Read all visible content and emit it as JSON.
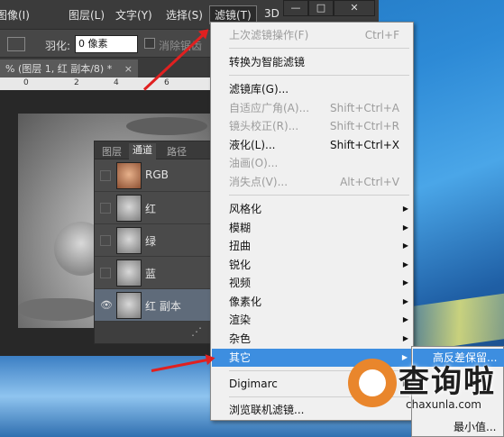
{
  "app": {
    "menubar": {
      "items": [
        "图像(I)",
        "图层(L)",
        "文字(Y)",
        "选择(S)",
        "滤镜(T)",
        "3D"
      ],
      "active": "滤镜(T)"
    },
    "window_controls": {
      "minimize": "—",
      "maximize": "□",
      "close": "✕"
    },
    "options": {
      "feather_label": "羽化:",
      "feather_value": "0 像素",
      "antialias_label": "消除锯齿"
    },
    "document_tab": {
      "title": "% (图层 1, 红 副本/8) *",
      "close": "×"
    },
    "ruler_ticks": [
      "0",
      "2",
      "4",
      "6"
    ]
  },
  "channels_panel": {
    "tabs": [
      "图层",
      "通道",
      "路径"
    ],
    "active_tab": "通道",
    "rows": [
      {
        "label": "RGB",
        "visible": false
      },
      {
        "label": "红",
        "visible": false
      },
      {
        "label": "绿",
        "visible": false
      },
      {
        "label": "蓝",
        "visible": false
      },
      {
        "label": "红 副本",
        "visible": true
      }
    ],
    "eye_icon": "👁",
    "footer_icon": "⋰"
  },
  "filter_menu": {
    "items": [
      {
        "label": "上次滤镜操作(F)",
        "shortcut": "Ctrl+F",
        "disabled": true
      },
      {
        "label": "转换为智能滤镜"
      },
      {
        "label": "滤镜库(G)..."
      },
      {
        "label": "自适应广角(A)...",
        "shortcut": "Shift+Ctrl+A",
        "disabled": true
      },
      {
        "label": "镜头校正(R)...",
        "shortcut": "Shift+Ctrl+R",
        "disabled": true
      },
      {
        "label": "液化(L)...",
        "shortcut": "Shift+Ctrl+X"
      },
      {
        "label": "油画(O)...",
        "disabled": true
      },
      {
        "label": "消失点(V)...",
        "shortcut": "Alt+Ctrl+V",
        "disabled": true
      },
      {
        "label": "风格化",
        "submenu": true
      },
      {
        "label": "模糊",
        "submenu": true
      },
      {
        "label": "扭曲",
        "submenu": true
      },
      {
        "label": "锐化",
        "submenu": true
      },
      {
        "label": "视频",
        "submenu": true
      },
      {
        "label": "像素化",
        "submenu": true
      },
      {
        "label": "渲染",
        "submenu": true
      },
      {
        "label": "杂色",
        "submenu": true
      },
      {
        "label": "其它",
        "submenu": true,
        "highlighted": true
      },
      {
        "label": "Digimarc",
        "submenu": true
      },
      {
        "label": "浏览联机滤镜..."
      }
    ],
    "submenu_arrow": "▶"
  },
  "other_submenu": {
    "highlighted": "高反差保留...",
    "last": "最小值..."
  },
  "watermark": {
    "title": "查询啦",
    "url": "chaxunla.com"
  }
}
